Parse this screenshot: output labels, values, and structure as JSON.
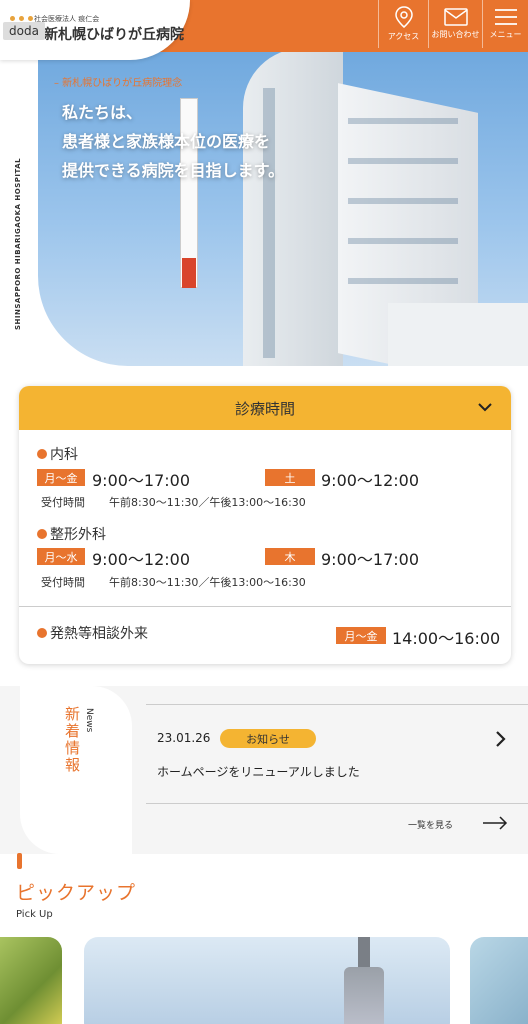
{
  "header": {
    "logo_sub": "社会医療法人 痕仁会",
    "logo_main": "新札幌ひばりが丘病院",
    "overlay_tag": "doda",
    "nav": [
      {
        "label": "アクセス",
        "icon": "map-pin-icon"
      },
      {
        "label": "お問い合わせ",
        "icon": "envelope-icon"
      },
      {
        "label": "メニュー",
        "icon": "hamburger-menu-icon"
      }
    ]
  },
  "hero": {
    "eyebrow": "– 新札幌ひばりが丘病院理念",
    "copy_lines": [
      "私たちは、",
      "患者様と家族様本位の医療を",
      "提供できる病院を目指します。"
    ],
    "vertical_text": "SHINSAPPORO HIBARIGAOKA HOSPITAL"
  },
  "hours": {
    "title": "診療時間",
    "departments": [
      {
        "name": "内科",
        "slots": [
          {
            "days": "月～金",
            "time": "9:00～17:00"
          },
          {
            "days": "土",
            "time": "9:00～12:00"
          }
        ],
        "reception_label": "受付時間",
        "reception": "午前8:30～11:30／午後13:00～16:30"
      },
      {
        "name": "整形外科",
        "slots": [
          {
            "days": "月～水",
            "time": "9:00～12:00"
          },
          {
            "days": "木",
            "time": "9:00～17:00"
          }
        ],
        "reception_label": "受付時間",
        "reception": "午前8:30～11:30／午後13:00～16:30"
      }
    ],
    "fever": {
      "name": "発熱等相談外来",
      "days": "月～金",
      "time": "14:00～16:00"
    }
  },
  "news": {
    "label_ja": "新着情報",
    "label_en": "News",
    "items": [
      {
        "date": "23.01.26",
        "category": "お知らせ",
        "title": "ホームページをリニューアルしました"
      }
    ],
    "more_label": "一覧を見る"
  },
  "pickup": {
    "title_ja": "ピックアップ",
    "title_en": "Pick Up"
  },
  "colors": {
    "accent_orange": "#e8742e",
    "accent_yellow": "#f4b432"
  }
}
